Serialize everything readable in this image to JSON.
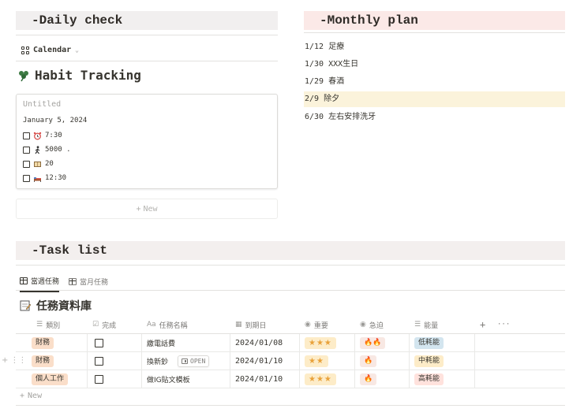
{
  "daily": {
    "heading": "-Daily check",
    "view_label": "Calendar",
    "habit_title": "Habit Tracking",
    "card": {
      "title": "Untitled",
      "date": "January 5, 2024",
      "items": [
        {
          "icon": "alarm-clock-icon",
          "text": "7:30"
        },
        {
          "icon": "walking-icon",
          "text": "5000 ."
        },
        {
          "icon": "book-icon",
          "text": "20"
        },
        {
          "icon": "bed-icon",
          "text": "12:30"
        }
      ]
    },
    "new_label": "New"
  },
  "monthly": {
    "heading": "-Monthly plan",
    "items": [
      {
        "text": "1/12 足療",
        "highlight": false
      },
      {
        "text": "1/30 XXX生日",
        "highlight": false
      },
      {
        "text": "1/29 春酒",
        "highlight": false
      },
      {
        "text": "2/9 除夕",
        "highlight": true
      },
      {
        "text": "6/30 左右安排洗牙",
        "highlight": false
      }
    ]
  },
  "tasks": {
    "heading": "-Task list",
    "tabs": [
      {
        "label": "當週任務",
        "active": true
      },
      {
        "label": "當月任務",
        "active": false
      }
    ],
    "db_title": "任務資料庫",
    "columns": [
      {
        "label": "類別",
        "icon": "list-icon"
      },
      {
        "label": "完成",
        "icon": "checkbox-icon"
      },
      {
        "label": "任務名稱",
        "icon": "text-icon",
        "prefix": "Aa"
      },
      {
        "label": "到期日",
        "icon": "calendar-icon"
      },
      {
        "label": "重要",
        "icon": "select-icon"
      },
      {
        "label": "急迫",
        "icon": "select-icon"
      },
      {
        "label": "能量",
        "icon": "list-icon"
      }
    ],
    "add_column": "+",
    "more": "···",
    "rows": [
      {
        "category": "財務",
        "done": false,
        "name": "繳電話費",
        "due": "2024/01/08",
        "important": "★★★",
        "urgent": "🔥🔥",
        "energy": "低耗能",
        "energy_color": "#d3e5ef"
      },
      {
        "category": "財務",
        "done": false,
        "name": "換新鈔",
        "due": "2024/01/10",
        "important": "★★",
        "urgent": "🔥",
        "energy": "中耗能",
        "energy_color": "#fdecc8",
        "open": "OPEN"
      },
      {
        "category": "個人工作",
        "done": false,
        "name": "做IG貼文模板",
        "due": "2024/01/10",
        "important": "★★★",
        "urgent": "🔥",
        "energy": "高耗能",
        "energy_color": "#ffe2dd"
      }
    ],
    "new_label": "New"
  },
  "colors": {
    "daily_bar": "#f1efef",
    "monthly_bar": "#fbe9e7",
    "task_bar": "#f3efee",
    "highlight_row": "#fbf3db",
    "category_pill": "#fadec9",
    "stars_pill": "#fdecc8",
    "fire_pill": "#f8e8e3"
  }
}
